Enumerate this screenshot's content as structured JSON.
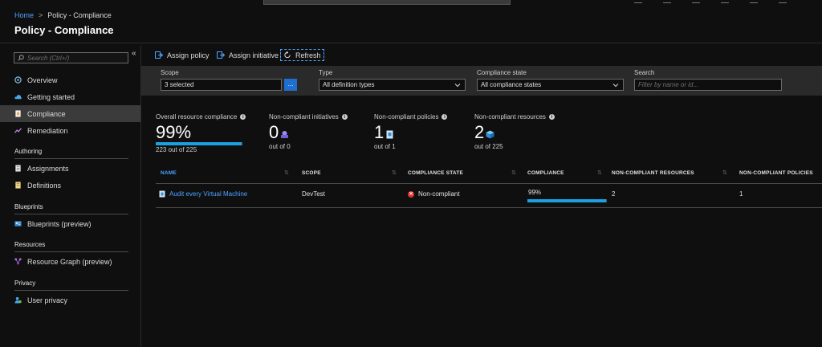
{
  "breadcrumb": {
    "home": "Home",
    "separator": ">",
    "current": "Policy - Compliance"
  },
  "page_title": "Policy - Compliance",
  "sidebar": {
    "search_placeholder": "Search (Ctrl+/)",
    "collapse_glyph": "«",
    "items_top": [
      {
        "label": "Overview",
        "icon": "overview-icon"
      },
      {
        "label": "Getting started",
        "icon": "cloud-icon"
      },
      {
        "label": "Compliance",
        "icon": "compliance-icon",
        "active": true
      },
      {
        "label": "Remediation",
        "icon": "remediation-icon"
      }
    ],
    "sections": [
      {
        "title": "Authoring",
        "items": [
          {
            "label": "Assignments",
            "icon": "assignments-icon"
          },
          {
            "label": "Definitions",
            "icon": "definitions-icon"
          }
        ]
      },
      {
        "title": "Blueprints",
        "items": [
          {
            "label": "Blueprints (preview)",
            "icon": "blueprints-icon"
          }
        ]
      },
      {
        "title": "Resources",
        "items": [
          {
            "label": "Resource Graph (preview)",
            "icon": "resource-graph-icon"
          }
        ]
      },
      {
        "title": "Privacy",
        "items": [
          {
            "label": "User privacy",
            "icon": "user-privacy-icon"
          }
        ]
      }
    ]
  },
  "toolbar": {
    "assign_policy": "Assign policy",
    "assign_initiative": "Assign initiative",
    "refresh": "Refresh"
  },
  "filters": {
    "scope_label": "Scope",
    "scope_value": "3 selected",
    "scope_button": "...",
    "type_label": "Type",
    "type_value": "All definition types",
    "state_label": "Compliance state",
    "state_value": "All compliance states",
    "search_label": "Search",
    "search_placeholder": "Filter by name or id..."
  },
  "summary": {
    "overall": {
      "label": "Overall resource compliance",
      "value": "99%",
      "sub": "223 out of 225",
      "progress": 0.99
    },
    "initiatives": {
      "label": "Non-compliant initiatives",
      "value": "0",
      "sub": "out of 0"
    },
    "policies": {
      "label": "Non-compliant policies",
      "value": "1",
      "sub": "out of 1"
    },
    "resources": {
      "label": "Non-compliant resources",
      "value": "2",
      "sub": "out of 225"
    }
  },
  "table": {
    "headers": [
      "NAME",
      "SCOPE",
      "COMPLIANCE STATE",
      "COMPLIANCE",
      "NON-COMPLIANT RESOURCES",
      "NON-COMPLIANT POLICIES"
    ],
    "rows": [
      {
        "name": "Audit every Virtual Machine",
        "scope": "DevTest",
        "state": "Non-compliant",
        "compliance": "99%",
        "compliance_progress": 0.99,
        "nc_resources": "2",
        "nc_policies": "1"
      }
    ]
  },
  "colors": {
    "accent": "#1ba1e2",
    "link": "#4da3ff",
    "error": "#e0312b",
    "active_nav": "#3b3b3b"
  }
}
